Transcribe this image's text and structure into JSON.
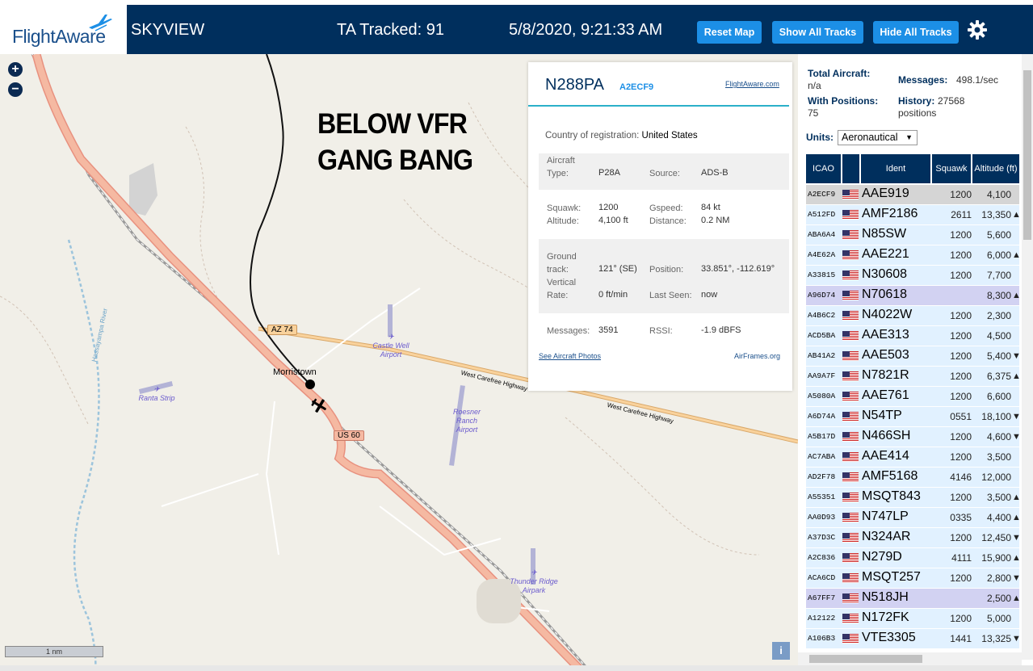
{
  "header": {
    "logo_text": "FlightAware",
    "app_title": "SKYVIEW",
    "tracked_label": "TA Tracked: 91",
    "datetime": "5/8/2020, 9:21:33 AM",
    "reset_map": "Reset Map",
    "show_all": "Show All Tracks",
    "hide_all": "Hide All Tracks"
  },
  "map": {
    "zoom_in": "+",
    "zoom_out": "−",
    "annotation_line1": "BELOW VFR",
    "annotation_line2": "GANG BANG",
    "labels": {
      "az74": "AZ 74",
      "us60": "US 60",
      "morristown": "Morristown",
      "highway1": "West Carefree Highway",
      "highway2": "West Carefree Highway",
      "river": "Hassayampa River",
      "castle_well": "Castle Well Airport",
      "ranta": "Ranta Strip",
      "roesner": "Roesner Ranch Airport",
      "thunder": "Thunder Ridge Airpark"
    },
    "scale": "1 nm",
    "info": "i"
  },
  "popup": {
    "ident": "N288PA",
    "icao": "A2ECF9",
    "fa_link": "FlightAware.com",
    "country_label": "Country of registration:",
    "country_value": "United States",
    "type_label": "Aircraft Type:",
    "type_value": "P28A",
    "source_label": "Source:",
    "source_value": "ADS-B",
    "squawk_label": "Squawk:",
    "squawk_value": "1200",
    "gspeed_label": "Gspeed:",
    "gspeed_value": "84 kt",
    "altitude_label": "Altitude:",
    "altitude_value": "4,100 ft",
    "distance_label": "Distance:",
    "distance_value": "0.2 NM",
    "track_label": "Ground track:",
    "track_value": "121° (SE)",
    "position_label": "Position:",
    "position_value": "33.851°, -112.619°",
    "vrate_label": "Vertical Rate:",
    "vrate_value": "0 ft/min",
    "lastseen_label": "Last Seen:",
    "lastseen_value": "now",
    "messages_label": "Messages:",
    "messages_value": "3591",
    "rssi_label": "RSSI:",
    "rssi_value": "-1.9 dBFS",
    "photos_link": "See Aircraft Photos",
    "airframes_link": "AirFrames.org"
  },
  "stats": {
    "total_label": "Total Aircraft:",
    "total_value": "n/a",
    "messages_label": "Messages:",
    "messages_value": "498.1/sec",
    "positions_label": "With Positions:",
    "positions_value": "75",
    "history_label": "History:",
    "history_value": "27568 positions",
    "units_label": "Units:",
    "units_value": "Aeronautical"
  },
  "table": {
    "headers": [
      "ICAO",
      "",
      "Ident",
      "Squawk",
      "Altitude (ft)"
    ],
    "rows": [
      {
        "icao": "A2ECF9",
        "ident": "AAE919",
        "squawk": "1200",
        "altitude": "4,100",
        "arrow": "",
        "style": "selected"
      },
      {
        "icao": "A512FD",
        "ident": "AMF2186",
        "squawk": "2611",
        "altitude": "13,350",
        "arrow": "▲",
        "style": "normal"
      },
      {
        "icao": "ABA6A4",
        "ident": "N85SW",
        "squawk": "1200",
        "altitude": "5,600",
        "arrow": "",
        "style": "normal"
      },
      {
        "icao": "A4E62A",
        "ident": "AAE221",
        "squawk": "1200",
        "altitude": "6,000",
        "arrow": "▲",
        "style": "normal"
      },
      {
        "icao": "A33815",
        "ident": "N30608",
        "squawk": "1200",
        "altitude": "7,700",
        "arrow": "",
        "style": "normal"
      },
      {
        "icao": "A96D74",
        "ident": "N70618",
        "squawk": "",
        "altitude": "8,300",
        "arrow": "▲",
        "style": "mlat"
      },
      {
        "icao": "A4B6C2",
        "ident": "N4022W",
        "squawk": "1200",
        "altitude": "2,300",
        "arrow": "",
        "style": "normal"
      },
      {
        "icao": "ACD5BA",
        "ident": "AAE313",
        "squawk": "1200",
        "altitude": "4,500",
        "arrow": "",
        "style": "normal"
      },
      {
        "icao": "AB41A2",
        "ident": "AAE503",
        "squawk": "1200",
        "altitude": "5,400",
        "arrow": "▼",
        "style": "normal"
      },
      {
        "icao": "AA9A7F",
        "ident": "N7821R",
        "squawk": "1200",
        "altitude": "6,375",
        "arrow": "▲",
        "style": "normal"
      },
      {
        "icao": "A5080A",
        "ident": "AAE761",
        "squawk": "1200",
        "altitude": "6,600",
        "arrow": "",
        "style": "normal"
      },
      {
        "icao": "A6D74A",
        "ident": "N54TP",
        "squawk": "0551",
        "altitude": "18,100",
        "arrow": "▼",
        "style": "normal"
      },
      {
        "icao": "A5B17D",
        "ident": "N466SH",
        "squawk": "1200",
        "altitude": "4,600",
        "arrow": "▼",
        "style": "normal"
      },
      {
        "icao": "AC7ABA",
        "ident": "AAE414",
        "squawk": "1200",
        "altitude": "3,500",
        "arrow": "",
        "style": "normal"
      },
      {
        "icao": "AD2F78",
        "ident": "AMF5168",
        "squawk": "4146",
        "altitude": "12,000",
        "arrow": "",
        "style": "normal"
      },
      {
        "icao": "A55351",
        "ident": "MSQT843",
        "squawk": "1200",
        "altitude": "3,500",
        "arrow": "▲",
        "style": "normal"
      },
      {
        "icao": "AA0D93",
        "ident": "N747LP",
        "squawk": "0335",
        "altitude": "4,400",
        "arrow": "▲",
        "style": "normal"
      },
      {
        "icao": "A37D3C",
        "ident": "N324AR",
        "squawk": "1200",
        "altitude": "12,450",
        "arrow": "▼",
        "style": "normal"
      },
      {
        "icao": "A2C836",
        "ident": "N279D",
        "squawk": "4111",
        "altitude": "15,900",
        "arrow": "▲",
        "style": "normal"
      },
      {
        "icao": "ACA6CD",
        "ident": "MSQT257",
        "squawk": "1200",
        "altitude": "2,800",
        "arrow": "▼",
        "style": "normal"
      },
      {
        "icao": "A67FF7",
        "ident": "N518JH",
        "squawk": "",
        "altitude": "2,500",
        "arrow": "▲",
        "style": "mlat"
      },
      {
        "icao": "A12122",
        "ident": "N172FK",
        "squawk": "1200",
        "altitude": "5,000",
        "arrow": "",
        "style": "normal"
      },
      {
        "icao": "A106B3",
        "ident": "VTE3305",
        "squawk": "1441",
        "altitude": "13,325",
        "arrow": "▼",
        "style": "normal"
      }
    ]
  },
  "colors": {
    "header_bg": "#002F5D",
    "button": "#1C8FE6",
    "row_normal": "#E1F1FF",
    "row_selected": "#D5D5D5",
    "row_mlat": "#D2D2F2"
  }
}
